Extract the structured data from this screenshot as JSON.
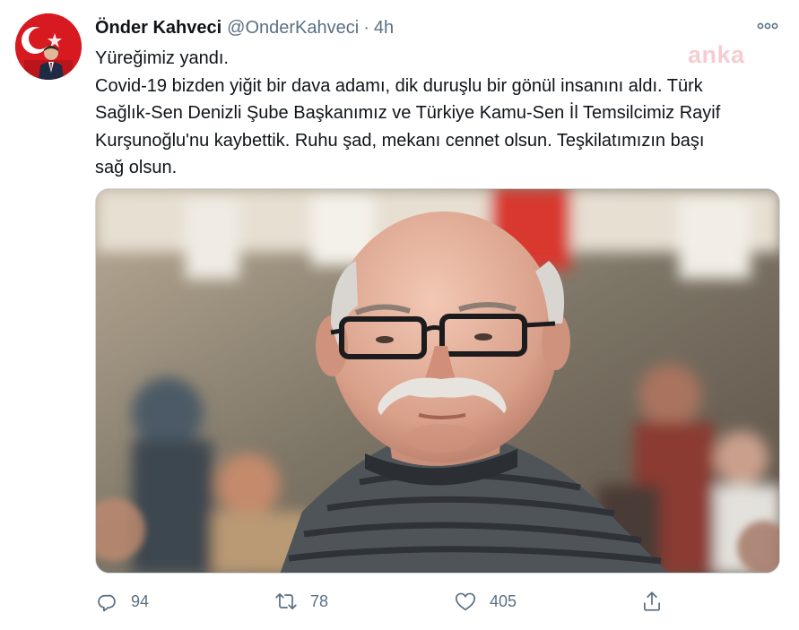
{
  "tweet": {
    "author_name": "Önder Kahveci",
    "author_handle": "@OnderKahveci",
    "separator": "·",
    "time": "4h",
    "more_icon": "more-dots-icon",
    "watermark": "anka",
    "lines": [
      "Yüreğimiz yandı.",
      "Covid-19 bizden yiğit bir dava adamı, dik duruşlu bir gönül insanını aldı. Türk",
      "Sağlık-Sen Denizli Şube Başkanımız ve Türkiye Kamu-Sen İl Temsilcimiz  Rayif",
      "Kurşunoğlu'nu kaybettik. Ruhu şad, mekanı cennet olsun. Teşkilatımızın başı",
      "sağ olsun."
    ]
  },
  "actions": {
    "reply": {
      "icon": "reply-icon",
      "count": "94"
    },
    "retweet": {
      "icon": "retweet-icon",
      "count": "78"
    },
    "like": {
      "icon": "like-icon",
      "count": "405"
    },
    "share": {
      "icon": "share-icon"
    }
  },
  "colors": {
    "secondary_text": "#5b7083",
    "primary_text": "#0f1419",
    "avatar_red": "#d71920"
  }
}
